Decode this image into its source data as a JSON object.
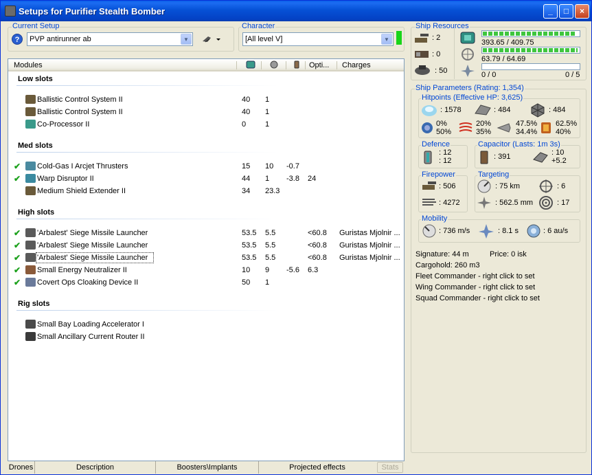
{
  "window": {
    "title": "Setups for Purifier Stealth Bomber",
    "min": "_",
    "max": "□",
    "close": "×"
  },
  "current_setup": {
    "label": "Current Setup",
    "value": "PVP antirunner ab"
  },
  "character": {
    "label": "Character",
    "value": "[All level V]"
  },
  "modules_panel": {
    "columns": {
      "modules": "Modules",
      "opti": "Opti...",
      "charges": "Charges"
    },
    "sections": {
      "low": "Low slots",
      "med": "Med slots",
      "high": "High slots",
      "rig": "Rig slots"
    },
    "low": [
      {
        "name": "Ballistic Control System II",
        "cpu": "40",
        "pg": "1",
        "cap": "",
        "opt": "",
        "charge": "",
        "check": ""
      },
      {
        "name": "Ballistic Control System II",
        "cpu": "40",
        "pg": "1",
        "cap": "",
        "opt": "",
        "charge": "",
        "check": ""
      },
      {
        "name": "Co-Processor II",
        "cpu": "0",
        "pg": "1",
        "cap": "",
        "opt": "",
        "charge": "",
        "check": ""
      }
    ],
    "med": [
      {
        "name": "Cold-Gas I Arcjet Thrusters",
        "cpu": "15",
        "pg": "10",
        "cap": "-0.7",
        "opt": "",
        "charge": "",
        "check": "✔"
      },
      {
        "name": "Warp Disruptor II",
        "cpu": "44",
        "pg": "1",
        "cap": "-3.8",
        "opt": "24",
        "charge": "",
        "check": "✔"
      },
      {
        "name": "Medium Shield Extender II",
        "cpu": "34",
        "pg": "23.3",
        "cap": "",
        "opt": "",
        "charge": "",
        "check": ""
      }
    ],
    "high": [
      {
        "name": "'Arbalest' Siege Missile Launcher",
        "cpu": "53.5",
        "pg": "5.5",
        "cap": "",
        "opt": "<60.8",
        "charge": "Guristas Mjolnir ...",
        "check": "✔"
      },
      {
        "name": "'Arbalest' Siege Missile Launcher",
        "cpu": "53.5",
        "pg": "5.5",
        "cap": "",
        "opt": "<60.8",
        "charge": "Guristas Mjolnir ...",
        "check": "✔"
      },
      {
        "name": "'Arbalest' Siege Missile Launcher",
        "cpu": "53.5",
        "pg": "5.5",
        "cap": "",
        "opt": "<60.8",
        "charge": "Guristas Mjolnir ...",
        "check": "✔"
      },
      {
        "name": "Small Energy Neutralizer II",
        "cpu": "10",
        "pg": "9",
        "cap": "-5.6",
        "opt": "6.3",
        "charge": "",
        "check": "✔"
      },
      {
        "name": "Covert Ops Cloaking Device II",
        "cpu": "50",
        "pg": "1",
        "cap": "",
        "opt": "",
        "charge": "",
        "check": "✔"
      }
    ],
    "rig": [
      {
        "name": "Small Bay Loading Accelerator I",
        "cpu": "",
        "pg": "",
        "cap": "",
        "opt": "",
        "charge": "",
        "check": ""
      },
      {
        "name": "Small Ancillary Current Router II",
        "cpu": "",
        "pg": "",
        "cap": "",
        "opt": "",
        "charge": "",
        "check": ""
      }
    ]
  },
  "bottom_tabs": [
    "Drones",
    "Description",
    "Boosters\\Implants",
    "Projected effects"
  ],
  "stats_button": "Stats",
  "ship_resources": {
    "label": "Ship Resources",
    "turrets": ": 2",
    "launchers": ": 0",
    "calibration": ": 50",
    "cpu": "393.65 / 409.75",
    "cpu_fraction": 0.961,
    "powergrid": "63.79 / 64.69",
    "pg_fraction": 0.986,
    "drone_bay": "0 / 0",
    "drone_bw": "0 / 5",
    "drone_fraction": 0
  },
  "ship_params": {
    "label": "Ship Parameters (Rating: 1,354)",
    "hitpoints": {
      "label": "Hitpoints (Effective HP: 3,625)",
      "shield": ": 1578",
      "armor": ": 484",
      "structure": ": 484",
      "em": [
        "0%",
        "50%"
      ],
      "thermal": [
        "20%",
        "35%"
      ],
      "kinetic": [
        "47.5%",
        "34.4%"
      ],
      "explosive": [
        "62.5%",
        "40%"
      ]
    },
    "defence": {
      "label": "Defence",
      "a": ": 12",
      "b": ": 12"
    },
    "capacitor": {
      "label": "Capacitor (Lasts: 1m 3s)",
      "amount": ": 391",
      "use": ": 10",
      "recharge": "+5.2"
    },
    "firepower": {
      "label": "Firepower",
      "dps": ": 506",
      "volley": ": 4272"
    },
    "targeting": {
      "label": "Targeting",
      "range": ": 75 km",
      "targets": ": 6",
      "scan_res": ": 562.5 mm",
      "sensor": ": 17"
    },
    "mobility": {
      "label": "Mobility",
      "speed": ": 736 m/s",
      "align": ": 8.1 s",
      "warp": ": 6 au/s"
    },
    "signature": "Signature: 44 m",
    "price": "Price: 0 isk",
    "cargohold": "Cargohold: 260 m3",
    "fleet_cmd": "Fleet Commander - right click to set",
    "wing_cmd": "Wing Commander - right click to set",
    "squad_cmd": "Squad Commander - right click to set"
  },
  "colors": {
    "accent": "#0046d5",
    "check": "#1ca11c",
    "bar": "#3fc63f"
  }
}
